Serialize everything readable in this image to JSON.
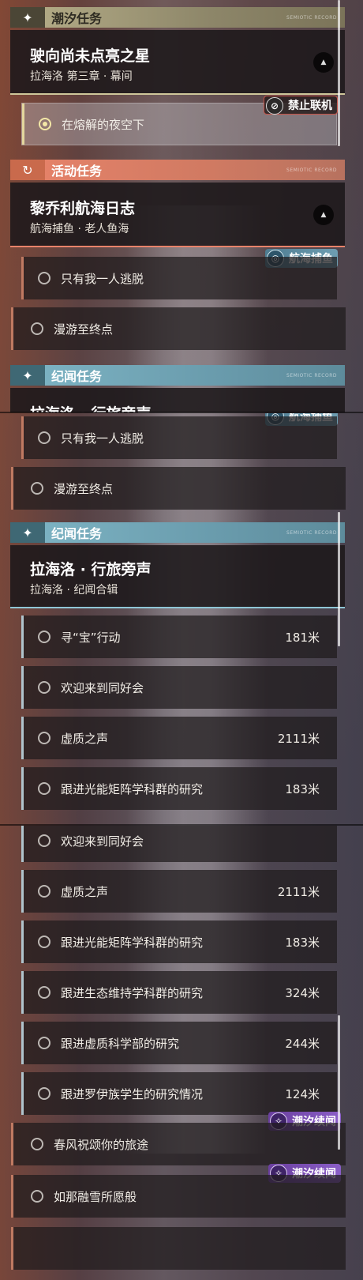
{
  "categories": {
    "tide": "潮汐任务",
    "event": "活动任务",
    "tale": "纪闻任务",
    "deco": "SEMIOTIC RECORD"
  },
  "quests": {
    "tide_main": {
      "title": "驶向尚未点亮之星",
      "subtitle": "拉海洛 第三章 · 幕间"
    },
    "tide_step": "在熔解的夜空下",
    "fishing": {
      "title": "黎乔利航海日志",
      "subtitle": "航海捕鱼 · 老人鱼海"
    },
    "fishing_steps": [
      "只有我一人逃脱",
      "漫游至终点"
    ],
    "tale": {
      "title": "拉海洛 · 行旅旁声",
      "title_clipped": "拉海洛 · 行旅旁声",
      "subtitle": "拉海洛 · 纪闻合辑"
    },
    "tale_steps": [
      {
        "name": "寻“宝”行动",
        "dist": "181米"
      },
      {
        "name": "欢迎来到同好会",
        "dist": ""
      },
      {
        "name": "虚质之声",
        "dist": "2111米"
      },
      {
        "name": "跟进光能矩阵学科群的研究",
        "dist": "183米"
      },
      {
        "name": "跟进生态维持学科群的研究",
        "dist": "324米"
      },
      {
        "name": "跟进虚质科学部的研究",
        "dist": "244米"
      },
      {
        "name": "跟进罗伊族学生的研究情况",
        "dist": "124米"
      }
    ],
    "tide_tales": [
      "春风祝颂你的旅途",
      "如那融雪所愿般"
    ]
  },
  "tags": {
    "no_coop": "禁止联机",
    "fishing": "航海捕鱼",
    "tide_tale": "潮汐续闻"
  },
  "icons": {
    "tide": "sparkle-icon",
    "event": "event-loop-icon",
    "tale": "sparkle-icon",
    "collapse": "chevron-up-icon",
    "radio": "radio-icon"
  },
  "colors": {
    "tide": "#b8b08a",
    "event": "#e8836a",
    "tale": "#7fb6c6",
    "tide_tale_tag": "#7a4fb3",
    "no_coop_border": "#c75247"
  }
}
